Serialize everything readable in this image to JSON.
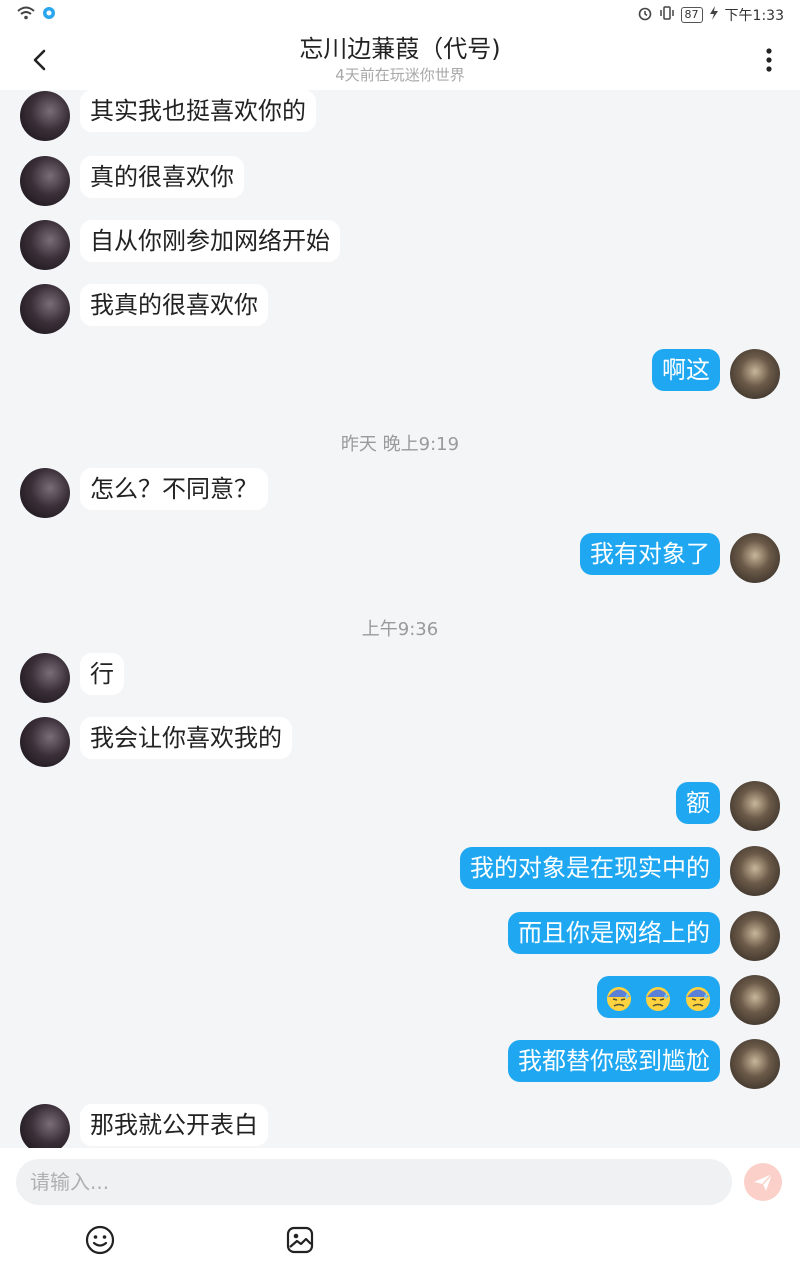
{
  "status_bar": {
    "battery": "87",
    "time": "下午1:33"
  },
  "header": {
    "title": "忘川边蒹葭（代号)",
    "subtitle": "4天前在玩迷你世界"
  },
  "messages": [
    {
      "text": "其实我也挺喜欢你的"
    },
    {
      "text": "真的很喜欢你"
    },
    {
      "text": "自从你刚参加网络开始"
    },
    {
      "text": "我真的很喜欢你"
    },
    {
      "text": "啊这"
    },
    {
      "text": "怎么？不同意？"
    },
    {
      "text": "我有对象了"
    },
    {
      "text": "行"
    },
    {
      "text": "我会让你喜欢我的"
    },
    {
      "text": "额"
    },
    {
      "text": "我的对象是在现实中的"
    },
    {
      "text": "而且你是网络上的"
    },
    {
      "text": "我都替你感到尴尬"
    },
    {
      "text": "那我就公开表白"
    }
  ],
  "timestamps": [
    {
      "text": "昨天 晚上9:19"
    },
    {
      "text": "上午9:36"
    }
  ],
  "input": {
    "placeholder": "请输入..."
  },
  "colors": {
    "self_bubble": "#1fa8f1",
    "other_bubble": "#ffffff",
    "background": "#f4f5f7",
    "send_button": "#fbd0c8"
  },
  "icons": {
    "back": "chevron-left-icon",
    "more": "more-vertical-icon",
    "send": "send-icon",
    "emoji": "emoji-icon",
    "image": "image-icon",
    "sweat_emoji": "anxious-face-with-sweat-icon"
  }
}
